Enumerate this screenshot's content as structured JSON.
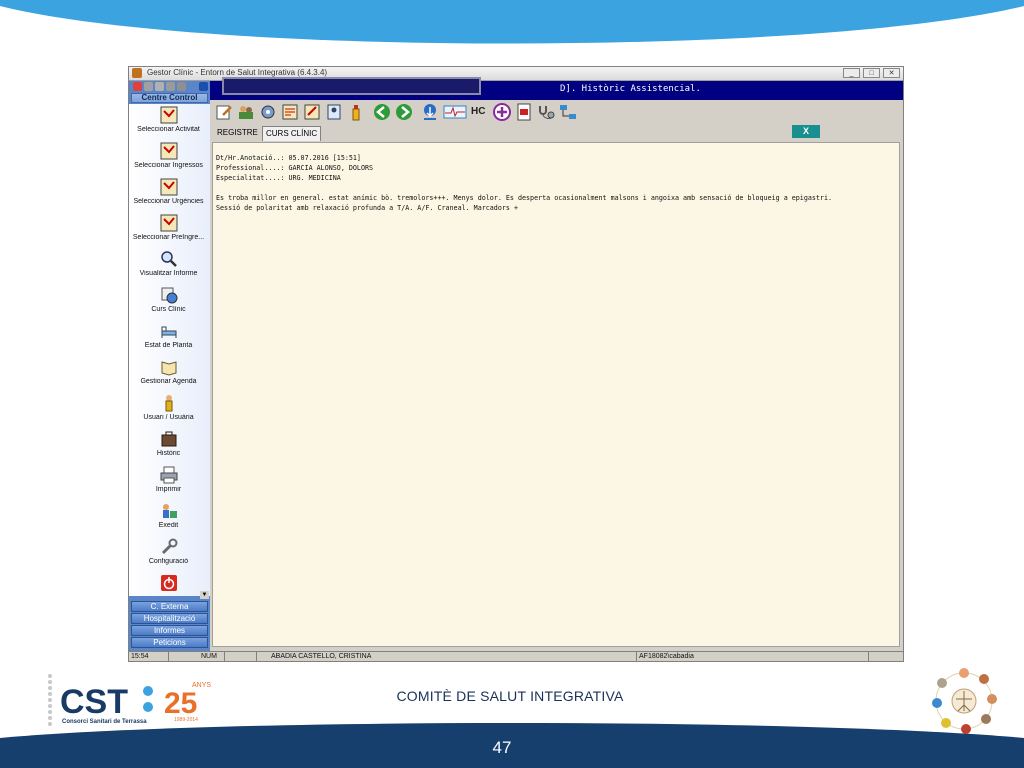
{
  "app": {
    "title": "Gestor Clínic - Entorn de Salut Integrativa (6.4.3.4)",
    "window_buttons": [
      "_",
      "□",
      "✕"
    ]
  },
  "sidebar": {
    "header": "Centre Control",
    "items": [
      {
        "label": "Seleccionar Activitat",
        "icon": "select-activity-icon"
      },
      {
        "label": "Seleccionar Ingressos",
        "icon": "select-admissions-icon"
      },
      {
        "label": "Seleccionar Urgències",
        "icon": "select-emergencies-icon"
      },
      {
        "label": "Seleccionar PreIngre...",
        "icon": "select-preadmissions-icon"
      },
      {
        "label": "Visualitzar Informe",
        "icon": "magnifier-icon"
      },
      {
        "label": "Curs Clínic",
        "icon": "clinical-course-icon"
      },
      {
        "label": "Estat de Planta",
        "icon": "bed-icon"
      },
      {
        "label": "Gestionar Agenda",
        "icon": "agenda-book-icon"
      },
      {
        "label": "Usuari / Usuària",
        "icon": "user-icon"
      },
      {
        "label": "Històric",
        "icon": "history-briefcase-icon"
      },
      {
        "label": "Imprimir",
        "icon": "printer-icon"
      },
      {
        "label": "Exedit",
        "icon": "exedit-icon"
      },
      {
        "label": "Configuració",
        "icon": "wrench-icon"
      },
      {
        "label": "",
        "icon": "power-icon"
      }
    ],
    "bottom_buttons": [
      "C. Externa",
      "Hospitalització",
      "Informes",
      "Peticions"
    ]
  },
  "main": {
    "header_title": "D]. Històric Assistencial.",
    "tabs": [
      "REGISTRE",
      "CURS CLÍNIC"
    ],
    "active_tab": "CURS CLÍNIC",
    "close_label": "X",
    "note": {
      "line1": "Dt/Hr.Anotació..: 05.07.2016 [15:51]",
      "line2": "Professional....: GARCIA ALONSO, DOLORS",
      "line3": "Especialitat....: URG. MEDICINA",
      "line4": "Es troba millor en general. estat anímic bò. tremolors+++. Menys dolor. Es desperta ocasionalment malsons i angoixa amb sensació de bloqueig a epigastri.",
      "line5": "Sessió de polaritat amb relaxació profunda a T/A. A/F. Craneal. Marcadors +"
    }
  },
  "toolbar_icons": [
    "edit-note-icon",
    "people-icon",
    "settings-gear-icon",
    "form-icon",
    "form-edit-icon",
    "user-card-icon",
    "bottle-icon",
    "back-arrow-icon",
    "forward-arrow-icon",
    "download-info-icon",
    "ecg-icon",
    "hc-icon",
    "add-circle-icon",
    "pdf-icon",
    "stethoscope-icon",
    "network-icon"
  ],
  "toolbar_hc_text": "HC",
  "statusbar": {
    "time": "15:54",
    "num": "NUM",
    "patient": "ABADIA CASTELLO, CRISTINA",
    "user": "AF18082\\cabadia"
  },
  "slide": {
    "logo_text": "CST",
    "logo_anys": "ANYS",
    "logo_years": "25",
    "logo_years_range": "1989-2014",
    "logo_subtitle": "Consorci Sanitari de Terrassa",
    "committee": "COMITÈ DE SALUT INTEGRATIVA",
    "page_number": "47",
    "colors": {
      "top_band": "#3aa3e0",
      "bottom_band": "#173f6e",
      "accent_orange": "#e8702a"
    }
  }
}
